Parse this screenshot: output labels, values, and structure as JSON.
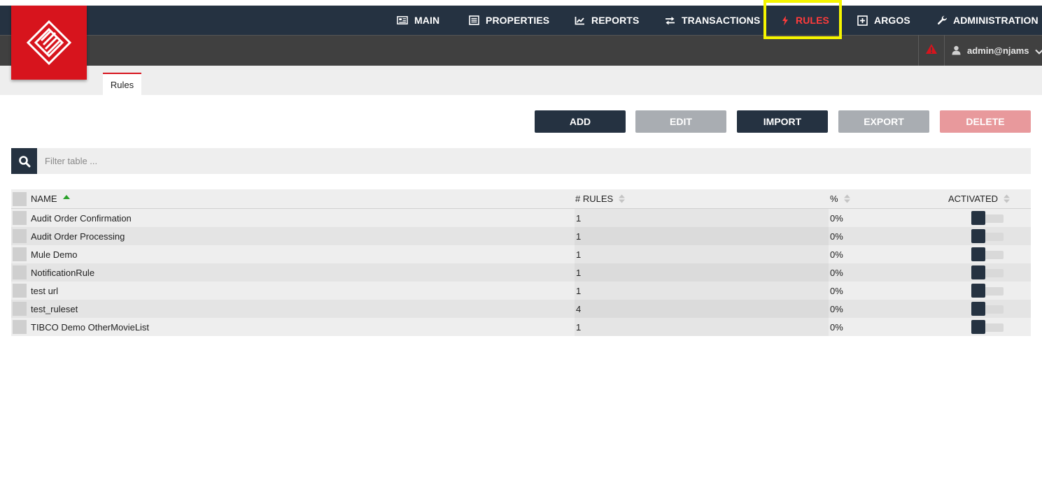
{
  "nav": {
    "items": [
      {
        "label": "MAIN",
        "icon": "newspaper-icon"
      },
      {
        "label": "PROPERTIES",
        "icon": "list-icon"
      },
      {
        "label": "REPORTS",
        "icon": "chart-line-icon"
      },
      {
        "label": "TRANSACTIONS",
        "icon": "exchange-icon"
      },
      {
        "label": "RULES",
        "icon": "bolt-icon"
      },
      {
        "label": "ARGOS",
        "icon": "plus-square-icon"
      },
      {
        "label": "ADMINISTRATION",
        "icon": "wrench-icon"
      }
    ],
    "active": "RULES"
  },
  "user": {
    "name": "admin@njams"
  },
  "tabs": [
    {
      "label": "Rules"
    }
  ],
  "toolbar": {
    "add": "ADD",
    "edit": "EDIT",
    "import": "IMPORT",
    "export": "EXPORT",
    "delete": "DELETE"
  },
  "filter": {
    "placeholder": "Filter table ..."
  },
  "table": {
    "columns": [
      "NAME",
      "# RULES",
      "%",
      "ACTIVATED"
    ],
    "rows": [
      {
        "name": "Audit Order Confirmation",
        "rules": "1",
        "percent": "0%",
        "activated": false
      },
      {
        "name": "Audit Order Processing",
        "rules": "1",
        "percent": "0%",
        "activated": false
      },
      {
        "name": "Mule Demo",
        "rules": "1",
        "percent": "0%",
        "activated": false
      },
      {
        "name": "NotificationRule",
        "rules": "1",
        "percent": "0%",
        "activated": false
      },
      {
        "name": "test url",
        "rules": "1",
        "percent": "0%",
        "activated": false
      },
      {
        "name": "test_ruleset",
        "rules": "4",
        "percent": "0%",
        "activated": false
      },
      {
        "name": "TIBCO Demo OtherMovieList",
        "rules": "1",
        "percent": "0%",
        "activated": false
      }
    ]
  },
  "colors": {
    "navy": "#253241",
    "brand_red": "#d7141d",
    "active_nav": "#ff3b3b",
    "highlight": "#f5f500",
    "disabled_grey": "#a9adb2",
    "delete_pink": "#e8999c"
  }
}
